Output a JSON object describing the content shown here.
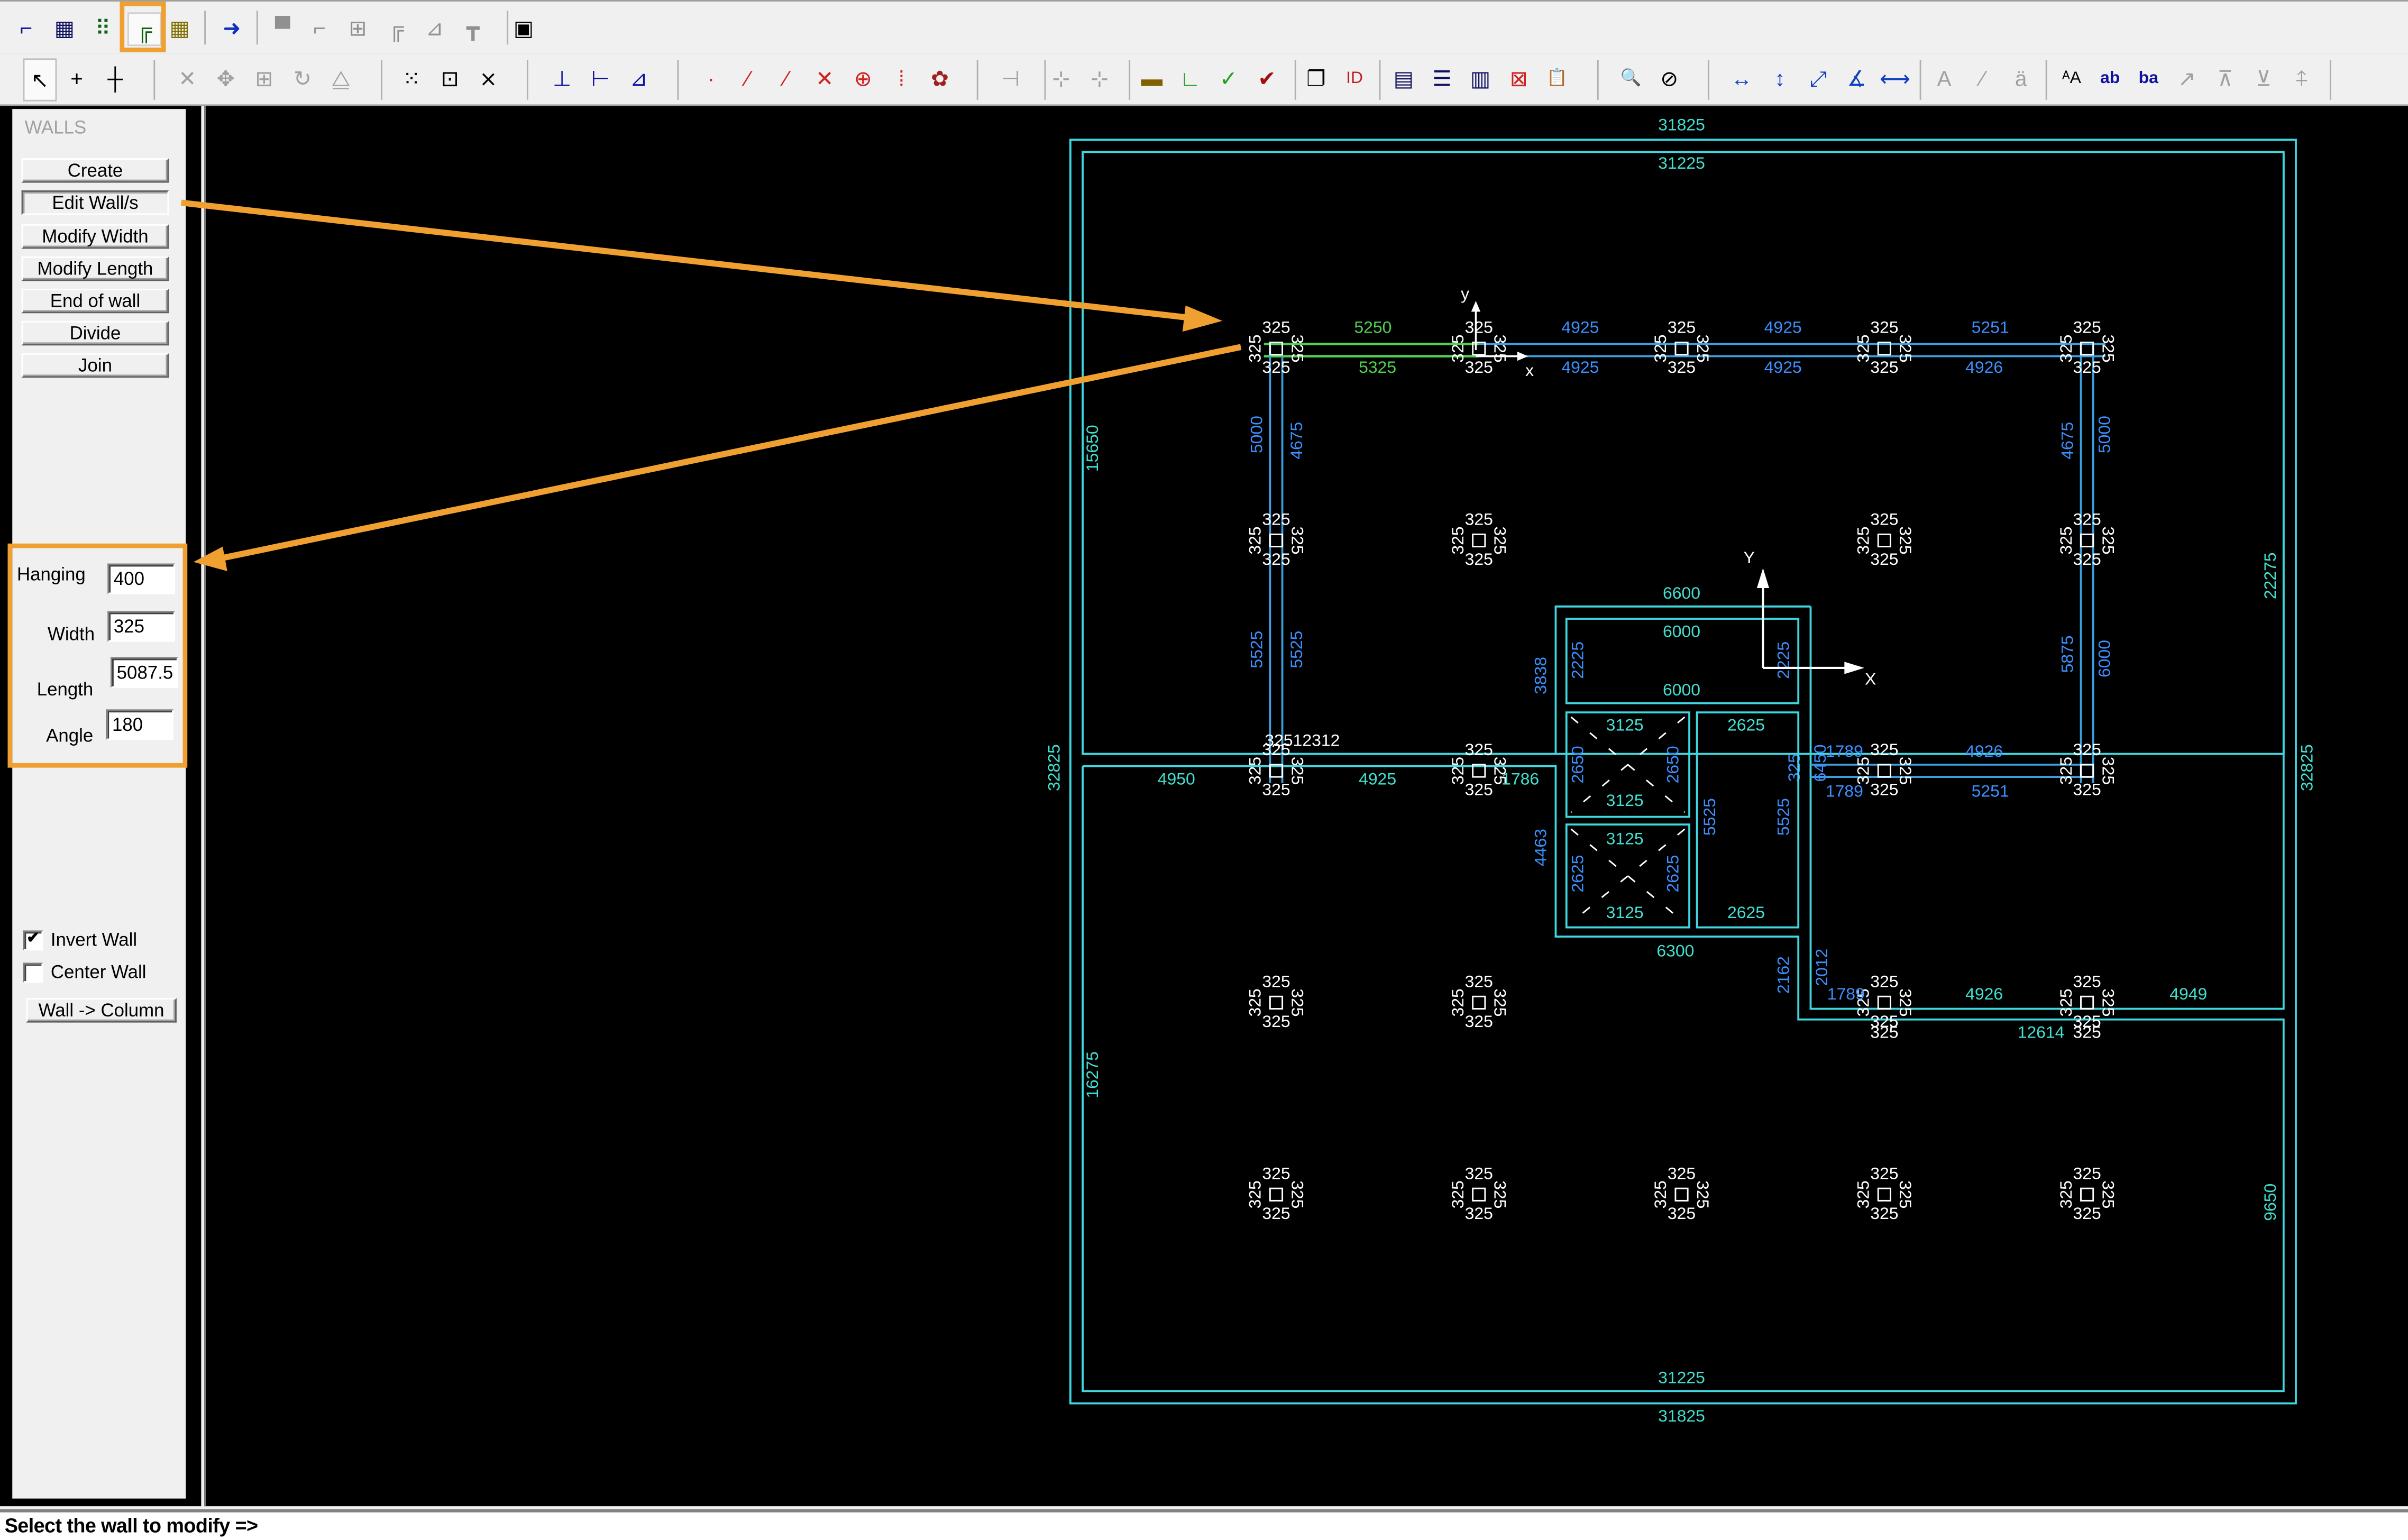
{
  "toolbar_top": {
    "items": [
      {
        "name": "slab-icon",
        "glyph": "⌐",
        "color": "#1010a0",
        "active": false
      },
      {
        "name": "hatched-slab-icon",
        "glyph": "▦",
        "color": "#101060",
        "active": false
      },
      {
        "name": "columns-icon",
        "glyph": "⠿",
        "color": "#106010",
        "active": false
      },
      {
        "name": "walls-icon",
        "glyph": "╔",
        "color": "#106010",
        "active": true
      },
      {
        "name": "grid-icon",
        "glyph": "▦",
        "color": "#807000",
        "active": false
      },
      {
        "name": "export-arrow-icon",
        "glyph": "➜",
        "color": "#1030c0",
        "active": false
      },
      {
        "name": "disabled-slab-icon",
        "glyph": "▀",
        "color": "#909090",
        "active": false
      },
      {
        "name": "disabled-beam-icon",
        "glyph": "⌐",
        "color": "#909090",
        "active": false
      },
      {
        "name": "disabled-columns-icon",
        "glyph": "⊞",
        "color": "#909090",
        "active": false
      },
      {
        "name": "disabled-wall-icon",
        "glyph": "╔",
        "color": "#909090",
        "active": false
      },
      {
        "name": "disabled-stair-icon",
        "glyph": "⊿",
        "color": "#909090",
        "active": false
      },
      {
        "name": "disabled-footing-icon",
        "glyph": "┳",
        "color": "#909090",
        "active": false
      },
      {
        "name": "save-icon",
        "glyph": "▣",
        "color": "#000000",
        "active": false
      }
    ]
  },
  "toolbar_main": {
    "items": [
      {
        "name": "select-pointer-icon",
        "glyph": "↖"
      },
      {
        "name": "small-crosshair-icon",
        "glyph": "+"
      },
      {
        "name": "large-crosshair-icon",
        "glyph": "┼"
      },
      {
        "name": "delete-icon",
        "glyph": "✕"
      },
      {
        "name": "move-icon",
        "glyph": "✥"
      },
      {
        "name": "copy-array-icon",
        "glyph": "⊞"
      },
      {
        "name": "rotate-icon",
        "glyph": "↻"
      },
      {
        "name": "mirror-icon",
        "glyph": "⧋"
      },
      {
        "name": "grid-points-icon",
        "glyph": "⁙"
      },
      {
        "name": "grid-snap-icon",
        "glyph": "⊡"
      },
      {
        "name": "grid-cross-icon",
        "glyph": "⨯"
      },
      {
        "name": "origin-icon",
        "glyph": "⊥"
      },
      {
        "name": "local-axis-icon",
        "glyph": "⊢"
      },
      {
        "name": "axis-rotate-icon",
        "glyph": "⊿"
      },
      {
        "name": "snap-point-icon",
        "glyph": "·"
      },
      {
        "name": "snap-endpoint-icon",
        "glyph": "⁄"
      },
      {
        "name": "snap-midpoint-icon",
        "glyph": "⁄"
      },
      {
        "name": "snap-intersection-icon",
        "glyph": "✕"
      },
      {
        "name": "snap-center-icon",
        "glyph": "⊕"
      },
      {
        "name": "snap-grid-icon",
        "glyph": "⁞"
      },
      {
        "name": "snap-object-icon",
        "glyph": "✿"
      },
      {
        "name": "measure-icon",
        "glyph": "⊣"
      },
      {
        "name": "align-vertical-icon",
        "glyph": "⊹"
      },
      {
        "name": "align-horizontal-icon",
        "glyph": "⊹"
      },
      {
        "name": "ruler-icon",
        "glyph": "▬"
      },
      {
        "name": "orthogonal-icon",
        "glyph": "∟"
      },
      {
        "name": "check-green-icon",
        "glyph": "✓"
      },
      {
        "name": "check-red-icon",
        "glyph": "✔"
      },
      {
        "name": "copy-properties-icon",
        "glyph": "❐"
      },
      {
        "name": "id-label-icon",
        "glyph": "ID"
      },
      {
        "name": "layers-icon",
        "glyph": "▤"
      },
      {
        "name": "table-icon",
        "glyph": "☰"
      },
      {
        "name": "columns-view-icon",
        "glyph": "▥"
      },
      {
        "name": "delete-table-icon",
        "glyph": "⊠"
      },
      {
        "name": "clipboard-icon",
        "glyph": "📋"
      },
      {
        "name": "zoom-window-icon",
        "glyph": "🔍"
      },
      {
        "name": "zoom-extents-icon",
        "glyph": "⊘"
      },
      {
        "name": "dimension-horizontal-icon",
        "glyph": "↔"
      },
      {
        "name": "dimension-vertical-icon",
        "glyph": "↕"
      },
      {
        "name": "dimension-aligned-icon",
        "glyph": "⤢"
      },
      {
        "name": "dimension-angle-icon",
        "glyph": "∡"
      },
      {
        "name": "dimension-chain-icon",
        "glyph": "⟷"
      },
      {
        "name": "text-icon",
        "glyph": "A"
      },
      {
        "name": "text-leader-icon",
        "glyph": "⁄"
      },
      {
        "name": "text-multiline-icon",
        "glyph": "ä"
      },
      {
        "name": "text-size-icon",
        "glyph": "ᴬA"
      },
      {
        "name": "text-ab-icon",
        "glyph": "ab"
      },
      {
        "name": "text-ba-icon",
        "glyph": "ba"
      },
      {
        "name": "text-pointer-icon",
        "glyph": "↗"
      },
      {
        "name": "text-rotate-icon",
        "glyph": "⊼"
      },
      {
        "name": "text-align-icon",
        "glyph": "⊻"
      },
      {
        "name": "text-align-center-icon",
        "glyph": "⍏"
      }
    ]
  },
  "panel": {
    "title": "WALLS",
    "buttons": [
      {
        "label": "Create",
        "pressed": false
      },
      {
        "label": "Edit Wall/s",
        "pressed": true
      },
      {
        "label": "Modify Width",
        "pressed": false
      },
      {
        "label": "Modify Length",
        "pressed": false
      },
      {
        "label": "End of wall",
        "pressed": false
      },
      {
        "label": "Divide",
        "pressed": false
      },
      {
        "label": "Join",
        "pressed": false
      }
    ],
    "fields": {
      "hanging": {
        "label": "Hanging",
        "value": "400"
      },
      "width": {
        "label": "Width",
        "value": "325"
      },
      "length": {
        "label": "Length",
        "value": "5087.5"
      },
      "angle": {
        "label": "Angle",
        "value": "180"
      }
    },
    "checkboxes": {
      "invert_wall": {
        "label": "Invert Wall",
        "checked": true
      },
      "center_wall": {
        "label": "Center Wall",
        "checked": false
      }
    },
    "wall_to_column_label": "Wall -> Column"
  },
  "status": {
    "prompt": "Select the wall to modify =>"
  },
  "colors": {
    "highlight": "#f0a030",
    "outline_cyan": "#40d8e0",
    "wall_blue": "#3aa0e0",
    "selected_wall_green": "#50d050",
    "dim_teal": "#40e0d0",
    "dim_blue": "#3a90ff",
    "white_text": "#ffffff",
    "canvas_bg": "#000000"
  },
  "drawing": {
    "outer_dims": {
      "top_outer": "31825",
      "top_inner": "31225",
      "bottom_inner": "31225",
      "bottom_outer": "31825",
      "left_outer": "32825",
      "right_outer": "32825",
      "left_upper": "15650",
      "left_lower": "16275",
      "right_upper": "22275",
      "right_lower": "9650"
    },
    "top_wall_dims": {
      "above": [
        "5250",
        "4925",
        "4925",
        "5251"
      ],
      "below": [
        "5325",
        "4925",
        "4925",
        "4926"
      ]
    },
    "left_wall_dims": {
      "outer": [
        "5000",
        "5525"
      ],
      "inner": [
        "4675",
        "5525"
      ]
    },
    "right_wall_dims": {
      "inner": [
        "4675",
        "5875"
      ],
      "outer": [
        "5000",
        "6000"
      ]
    },
    "mid_wall_dims": {
      "left_top_label": "32512312",
      "below": [
        "4950",
        "4925",
        "1786"
      ]
    },
    "right_mid_wall_dims": {
      "left_vertical": "6450",
      "left_vertical2": "325",
      "above": [
        "1789",
        "4926"
      ],
      "below": [
        "1789",
        "5251"
      ]
    },
    "core": {
      "outer_top": "6600",
      "outer_bottom": "6300",
      "outer_left_upper": "3838",
      "outer_left_lower": "4463",
      "lift_top": "6000",
      "lift_bottom": "6000",
      "lift_left": "2225",
      "lift_right": "2225",
      "stair1_top": "3125",
      "stair1_bottom": "3125",
      "stair1_left": "2650",
      "stair1_right": "2650",
      "stair2_top": "3125",
      "stair2_bottom": "3125",
      "stair2_left": "2625",
      "stair2_right": "2625",
      "shaft_top": "2625",
      "shaft_bottom": "2625",
      "shaft_left": "5525",
      "shaft_right": "5525",
      "right_lower_a": "2162",
      "right_lower_b": "2012"
    },
    "lower_wall_dims": {
      "above": [
        "1789",
        "4926",
        "4949"
      ],
      "below": [
        "325",
        "12614",
        "325"
      ]
    },
    "column_size": "325",
    "global_axis": {
      "x": "X",
      "y": "Y"
    },
    "local_axis": {
      "x": "x",
      "y": "y"
    }
  }
}
